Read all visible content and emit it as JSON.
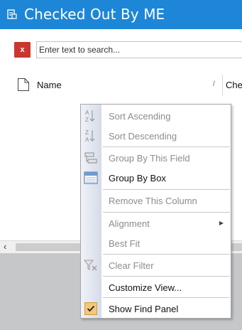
{
  "window": {
    "title": "Checked Out By ME"
  },
  "search": {
    "clear_label": "x",
    "placeholder": "Enter text to search..."
  },
  "grid": {
    "columns": [
      {
        "label": "Name",
        "sort_indicator": "/"
      },
      {
        "label": "Che"
      }
    ],
    "scroll_left_glyph": "‹"
  },
  "context_menu": {
    "items": [
      {
        "label": "Sort Ascending",
        "icon": "sort-ascending-icon",
        "enabled": false
      },
      {
        "label": "Sort Descending",
        "icon": "sort-descending-icon",
        "enabled": false
      },
      {
        "label": "Group By This Field",
        "icon": "group-by-field-icon",
        "enabled": false
      },
      {
        "label": "Group By Box",
        "icon": "group-by-box-icon",
        "enabled": true
      },
      {
        "label": "Remove This Column",
        "enabled": false
      },
      {
        "label": "Alignment",
        "enabled": false,
        "submenu_glyph": "▶"
      },
      {
        "label": "Best Fit",
        "enabled": false
      },
      {
        "label": "Clear Filter",
        "icon": "clear-filter-icon",
        "enabled": false
      },
      {
        "label": "Customize View...",
        "enabled": true
      },
      {
        "label": "Show Find Panel",
        "icon": "checkmark-icon",
        "enabled": true,
        "checked": true
      }
    ]
  },
  "colors": {
    "title_bar": "#1e86d6",
    "clear_button": "#c9372f",
    "check_highlight": "#f5c77a"
  }
}
